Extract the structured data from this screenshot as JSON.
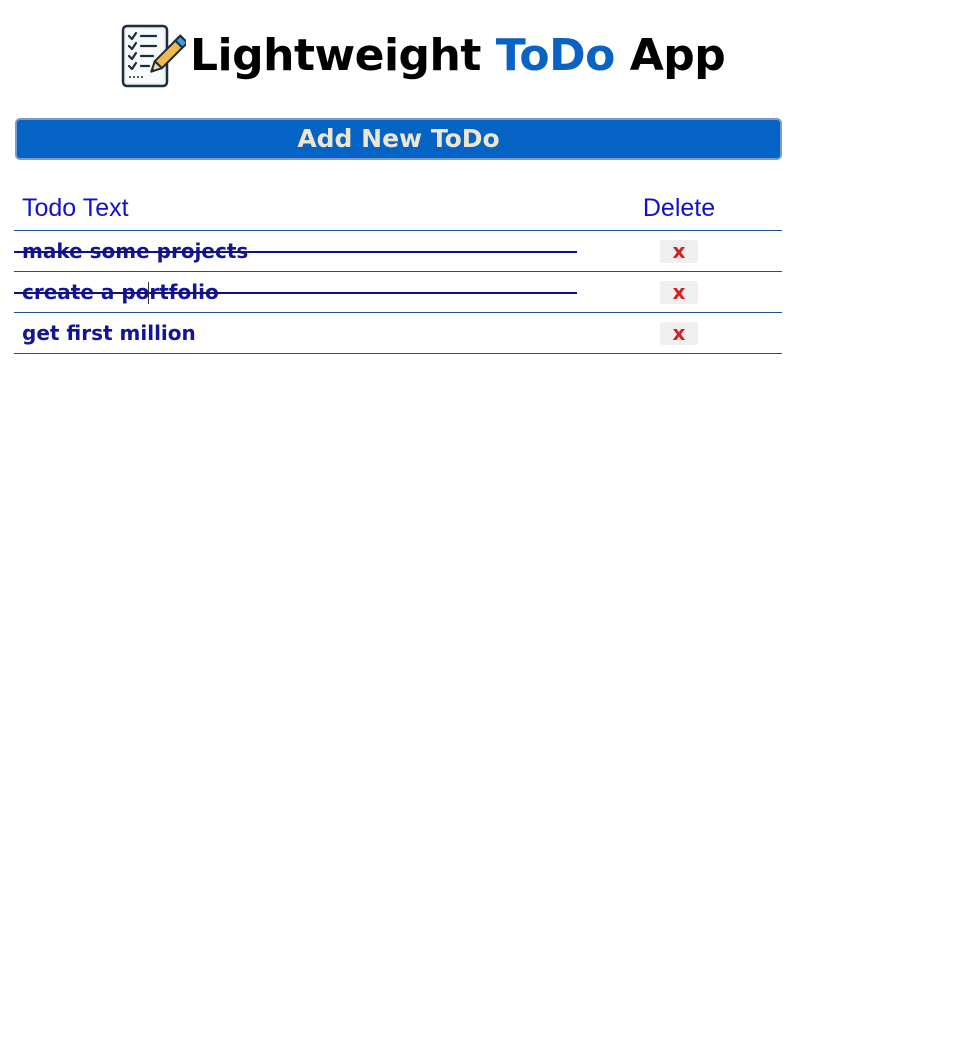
{
  "header": {
    "title_part1": "Lightweight ",
    "title_accent": "ToDo",
    "title_part2": " App",
    "logo_icon": "checklist-pencil-icon",
    "accent_color": "#0a62c4"
  },
  "add_button": {
    "label": "Add New ToDo",
    "background": "#0563c6"
  },
  "table": {
    "columns": [
      "Todo Text",
      "Delete"
    ],
    "rows": [
      {
        "text": "make some projects",
        "completed": true,
        "delete_label": "x"
      },
      {
        "text": "create a portfolio",
        "completed": true,
        "delete_label": "x"
      },
      {
        "text": "get first million",
        "completed": false,
        "delete_label": "x"
      }
    ]
  }
}
